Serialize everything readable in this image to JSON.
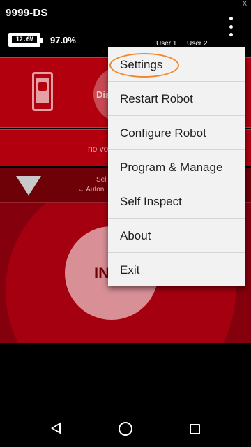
{
  "status": {
    "device_name": "9999-DS",
    "battery_icon": "battery-icon",
    "battery_text": "12.6V",
    "battery_percent": "97.0%",
    "close_mark": "X"
  },
  "users": {
    "user1": "User 1",
    "user2": "User 2"
  },
  "driver_station": {
    "disable_label": "Dis",
    "no_voltage_text": "no vo",
    "selector_line1": "Sel",
    "selector_line2": "← Auton",
    "init_label": "IN"
  },
  "menu": {
    "items": [
      {
        "label": "Settings"
      },
      {
        "label": "Restart Robot"
      },
      {
        "label": "Configure Robot"
      },
      {
        "label": "Program & Manage"
      },
      {
        "label": "Self Inspect"
      },
      {
        "label": "About"
      },
      {
        "label": "Exit"
      }
    ],
    "highlight_color": "#f0882e"
  },
  "colors": {
    "panel_red": "#b3000f",
    "dark_red": "#84000c",
    "menu_bg": "#f2f2f2"
  }
}
